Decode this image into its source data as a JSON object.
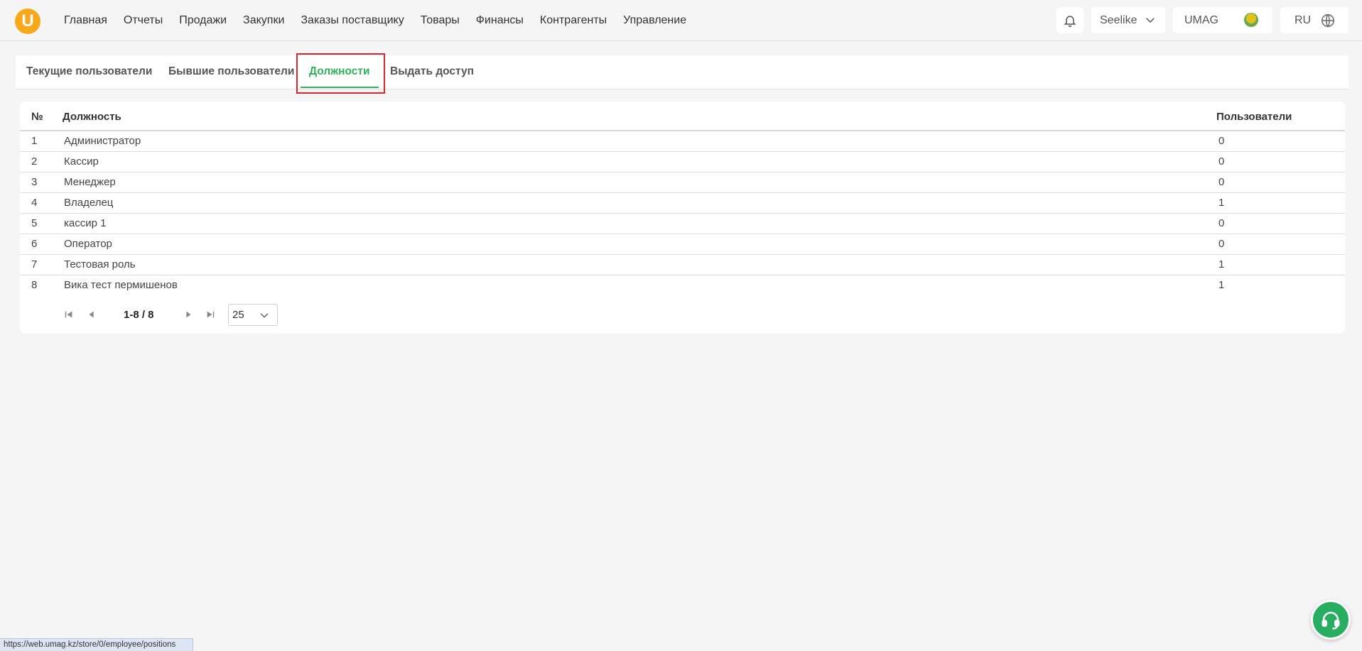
{
  "header": {
    "logo_letter": "U",
    "nav": [
      "Главная",
      "Отчеты",
      "Продажи",
      "Закупки",
      "Заказы поставщику",
      "Товары",
      "Финансы",
      "Контрагенты",
      "Управление"
    ],
    "store_name": "Seelike",
    "user_name": "UMAG",
    "language": "RU"
  },
  "tabs": [
    "Текущие пользователи",
    "Бывшие пользователи",
    "Должности",
    "Выдать доступ"
  ],
  "active_tab_index": 2,
  "table": {
    "columns": {
      "num": "№",
      "position": "Должность",
      "users": "Пользователи"
    },
    "rows": [
      {
        "num": "1",
        "position": "Администратор",
        "users": "0"
      },
      {
        "num": "2",
        "position": "Кассир",
        "users": "0"
      },
      {
        "num": "3",
        "position": "Менеджер",
        "users": "0"
      },
      {
        "num": "4",
        "position": "Владелец",
        "users": "1"
      },
      {
        "num": "5",
        "position": "кассир 1",
        "users": "0"
      },
      {
        "num": "6",
        "position": "Оператор",
        "users": "0"
      },
      {
        "num": "7",
        "position": "Тестовая роль",
        "users": "1"
      },
      {
        "num": "8",
        "position": "Вика тест пермишенов",
        "users": "1"
      }
    ]
  },
  "pager": {
    "range": "1-8 / 8",
    "page_size": "25"
  },
  "statusbar_url": "https://web.umag.kz/store/0/employee/positions",
  "colors": {
    "accent": "#2fb25a",
    "logo": "#f7a81b",
    "support": "#27ae60",
    "highlight": "#d9262c"
  }
}
